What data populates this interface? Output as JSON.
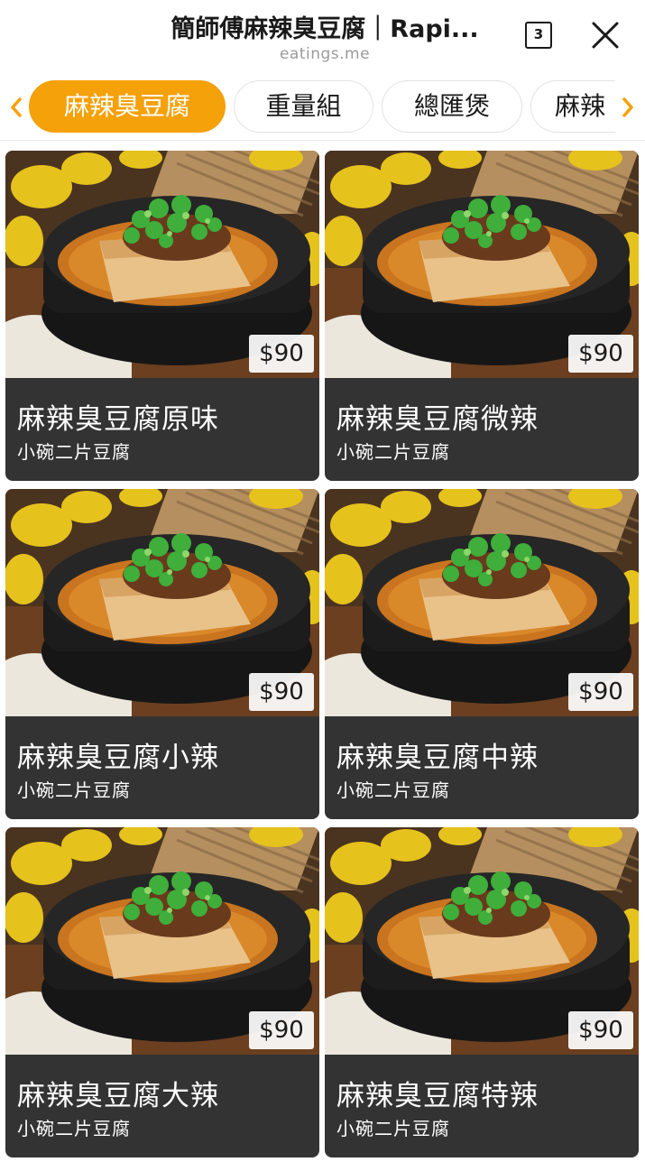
{
  "browser": {
    "title": "簡師傅麻辣臭豆腐｜Rapi...",
    "domain": "eatings.me",
    "tab_count": "3"
  },
  "icons": {
    "close": "close-icon",
    "back": "chevron-left-icon",
    "forward": "chevron-right-icon"
  },
  "colors": {
    "accent": "#f5a10a",
    "card_bg": "#333333"
  },
  "categories": [
    {
      "label": "麻辣臭豆腐",
      "active": true
    },
    {
      "label": "重量組",
      "active": false
    },
    {
      "label": "總匯煲",
      "active": false
    },
    {
      "label": "麻辣",
      "active": false
    }
  ],
  "menu_items": [
    {
      "name": "麻辣臭豆腐原味",
      "description": "小碗二片豆腐",
      "price": "$90"
    },
    {
      "name": "麻辣臭豆腐微辣",
      "description": "小碗二片豆腐",
      "price": "$90"
    },
    {
      "name": "麻辣臭豆腐小辣",
      "description": "小碗二片豆腐",
      "price": "$90"
    },
    {
      "name": "麻辣臭豆腐中辣",
      "description": "小碗二片豆腐",
      "price": "$90"
    },
    {
      "name": "麻辣臭豆腐大辣",
      "description": "小碗二片豆腐",
      "price": "$90"
    },
    {
      "name": "麻辣臭豆腐特辣",
      "description": "小碗二片豆腐",
      "price": "$90"
    }
  ]
}
